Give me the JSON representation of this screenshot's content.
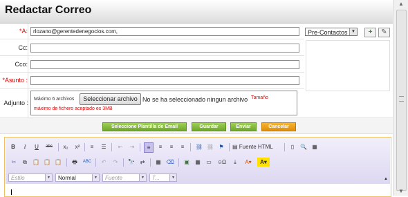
{
  "title": "Redactar Correo",
  "fields": {
    "to": {
      "label": "*A:",
      "value": "rlozano@gerentedenegocios.com,"
    },
    "cc": {
      "label": "Cc:",
      "value": ""
    },
    "cco": {
      "label": "Cco:",
      "value": ""
    },
    "subject": {
      "label": "*Asunto :",
      "value": ""
    }
  },
  "contacts_select": "Pre-Contactos",
  "attachment": {
    "label": "Adjunto :",
    "max": "Máximo 6 archivos",
    "button": "Seleccionar archivo",
    "none": "No se ha seleccionado ningun archivo",
    "warn1": "Tamaño",
    "warn2": "máximo de fichero aceptado es 3MB"
  },
  "actions": {
    "template": "Seleccione Plantilla de Email",
    "save": "Guardar",
    "send": "Enviar",
    "cancel": "Cancelar"
  },
  "toolbar": {
    "bold": "B",
    "italic": "I",
    "underline": "U",
    "strike": "abc",
    "sub": "x₂",
    "sup": "x²",
    "source": "Fuente HTML",
    "spell": "ABC",
    "omega": "Ω"
  },
  "combos": {
    "style": "Estilo",
    "format": "Normal",
    "font": "Fuente",
    "size": "T..."
  },
  "colors": {
    "green": "#7cb83a",
    "orange": "#f0a020",
    "required": "#dd0000"
  }
}
